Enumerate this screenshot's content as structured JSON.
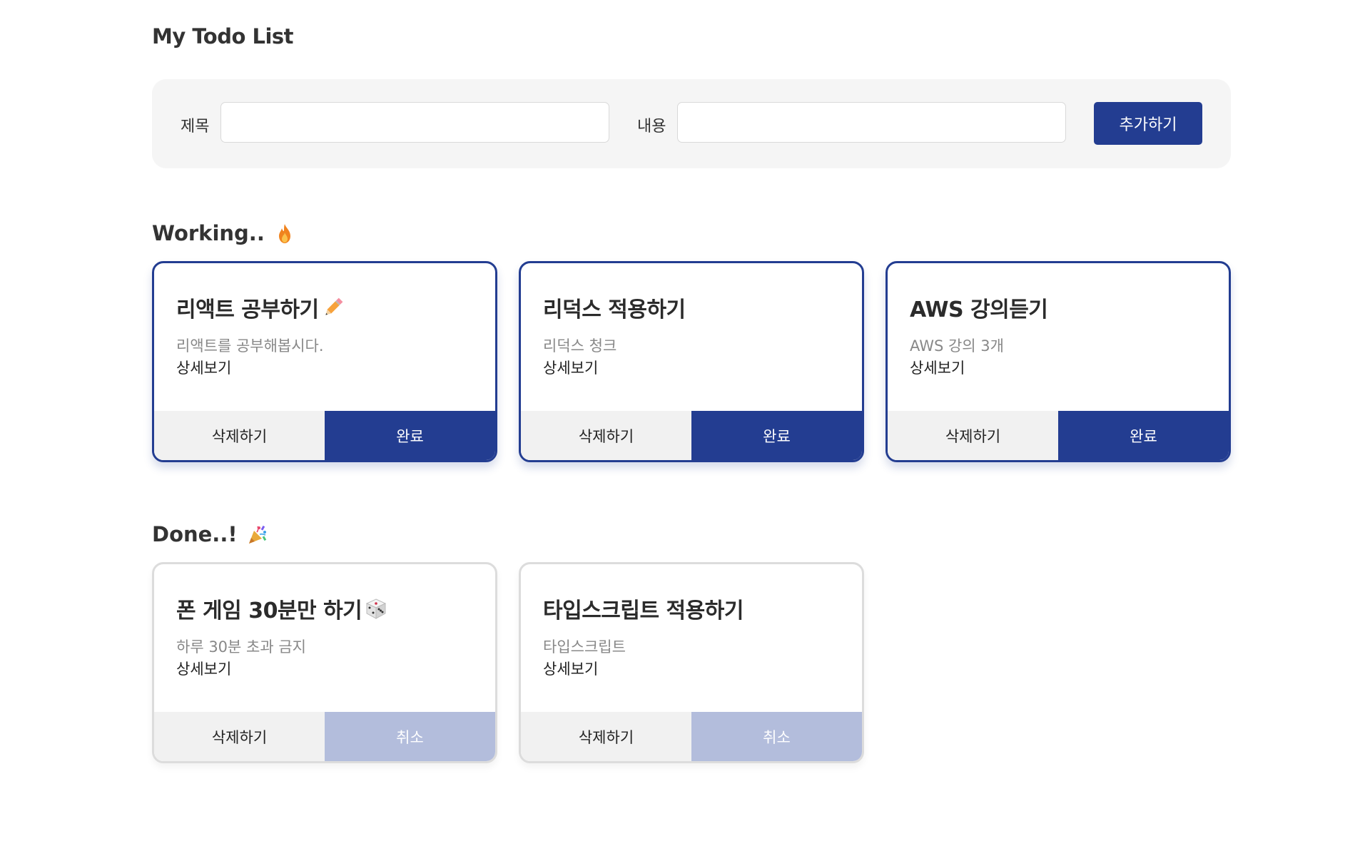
{
  "page_title": "My Todo List",
  "form": {
    "title_label": "제목",
    "title_value": "",
    "content_label": "내용",
    "content_value": "",
    "add_label": "추가하기"
  },
  "working_section": {
    "title": "Working..",
    "emoji": "fire-icon",
    "cards": [
      {
        "title": "리액트 공부하기",
        "emoji": "pencil-icon",
        "content": "리액트를 공부해봅시다.",
        "detail": "상세보기",
        "delete_label": "삭제하기",
        "complete_label": "완료"
      },
      {
        "title": "리덕스 적용하기",
        "emoji": "",
        "content": "리덕스 청크",
        "detail": "상세보기",
        "delete_label": "삭제하기",
        "complete_label": "완료"
      },
      {
        "title": "AWS 강의듣기",
        "emoji": "",
        "content": "AWS 강의 3개",
        "detail": "상세보기",
        "delete_label": "삭제하기",
        "complete_label": "완료"
      }
    ]
  },
  "done_section": {
    "title": "Done..!",
    "emoji": "party-popper-icon",
    "cards": [
      {
        "title": "폰 게임 30분만 하기",
        "emoji": "dice-icon",
        "content": "하루 30분 초과 금지",
        "detail": "상세보기",
        "delete_label": "삭제하기",
        "cancel_label": "취소"
      },
      {
        "title": "타입스크립트 적용하기",
        "emoji": "",
        "content": "타입스크립트",
        "detail": "상세보기",
        "delete_label": "삭제하기",
        "cancel_label": "취소"
      }
    ]
  },
  "colors": {
    "primary": "#233d91",
    "primary_light": "#b3bddc",
    "form_bg": "#f5f5f5",
    "delete_bg": "#f1f1f1",
    "done_border": "#dcdcdc"
  }
}
